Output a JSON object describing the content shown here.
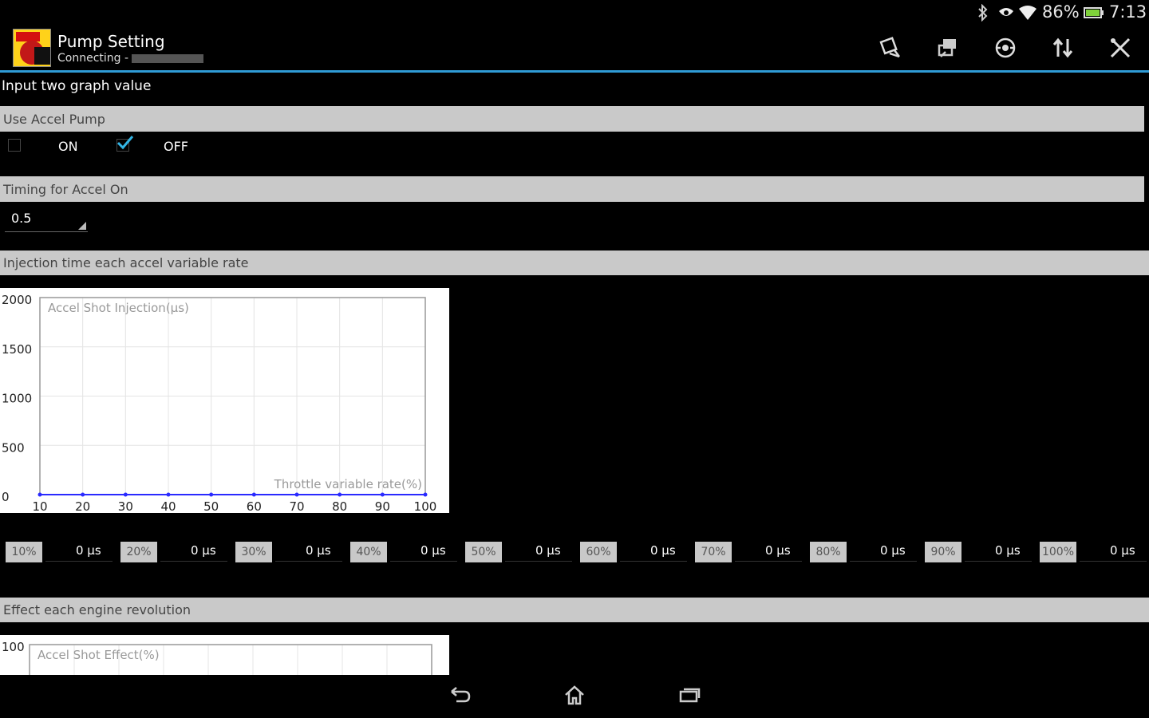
{
  "status_bar": {
    "battery": "86%",
    "time": "7:13"
  },
  "action_bar": {
    "title": "Pump Setting",
    "subtitle": "Connecting -",
    "actions": [
      "save-icon",
      "transfer-icon",
      "scan-icon",
      "sort-icon",
      "tools-icon"
    ]
  },
  "intro": "Input two graph value",
  "accel_pump": {
    "header": "Use Accel Pump",
    "on_label": "ON",
    "off_label": "OFF",
    "on_checked": false,
    "off_checked": true
  },
  "timing": {
    "header": "Timing for Accel On",
    "value": "0.5"
  },
  "injection": {
    "header": "Injection time each accel variable rate",
    "rates": [
      {
        "label": "10%",
        "value": "0 μs"
      },
      {
        "label": "20%",
        "value": "0 μs"
      },
      {
        "label": "30%",
        "value": "0 μs"
      },
      {
        "label": "40%",
        "value": "0 μs"
      },
      {
        "label": "50%",
        "value": "0 μs"
      },
      {
        "label": "60%",
        "value": "0 μs"
      },
      {
        "label": "70%",
        "value": "0 μs"
      },
      {
        "label": "80%",
        "value": "0 μs"
      },
      {
        "label": "90%",
        "value": "0 μs"
      },
      {
        "label": "100%",
        "value": "0 μs"
      }
    ]
  },
  "effect": {
    "header": "Effect each engine revolution"
  },
  "chart_data": [
    {
      "type": "line",
      "title": "Accel Shot Injection(μs)",
      "xlabel": "Throttle variable rate(%)",
      "ylabel": "",
      "x": [
        10,
        20,
        30,
        40,
        50,
        60,
        70,
        80,
        90,
        100
      ],
      "series": [
        {
          "values": [
            0,
            0,
            0,
            0,
            0,
            0,
            0,
            0,
            0,
            0
          ],
          "color": "#2a2aff"
        }
      ],
      "xlim": [
        10,
        100
      ],
      "ylim": [
        0,
        2000
      ],
      "yticks": [
        0,
        500,
        1000,
        1500,
        2000
      ],
      "xticks": [
        10,
        20,
        30,
        40,
        50,
        60,
        70,
        80,
        90,
        100
      ],
      "grid": true
    },
    {
      "type": "line",
      "title": "Accel Shot Effect(%)",
      "yticks": [
        100
      ],
      "grid": true
    }
  ],
  "colors": {
    "accent": "#2f9bd6",
    "checkbox": "#33b5e5",
    "series": "#2a2aff"
  }
}
